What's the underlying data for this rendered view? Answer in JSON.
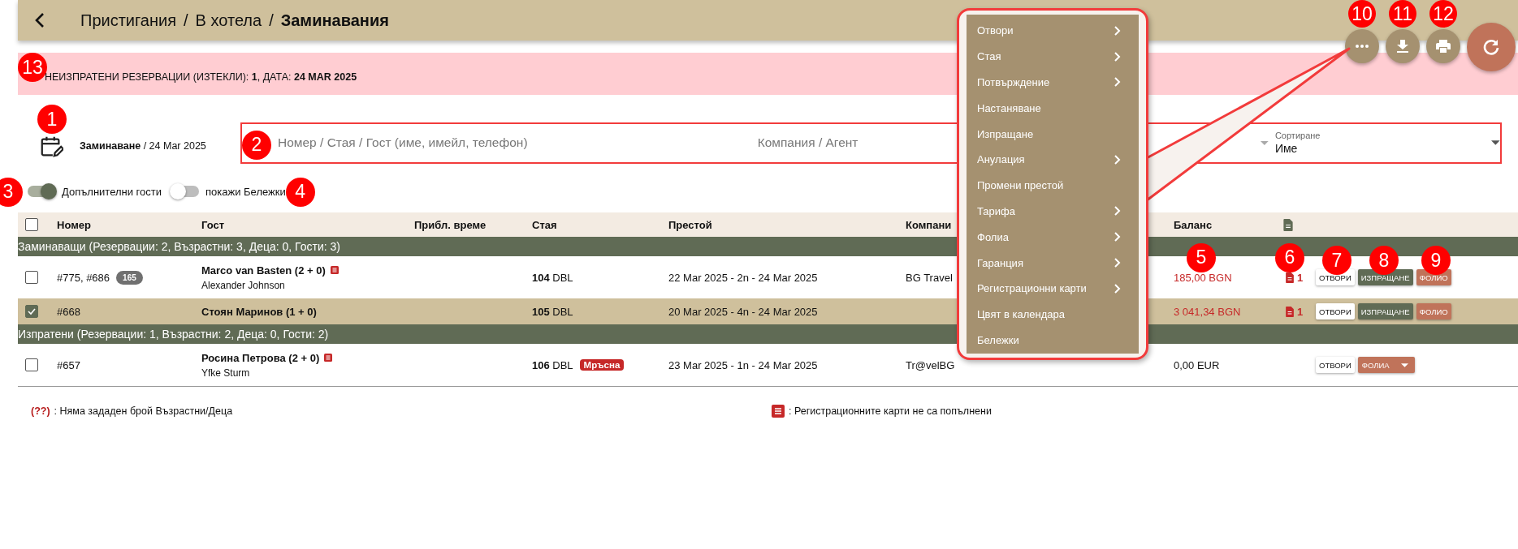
{
  "header": {
    "separator": "/",
    "breadcrumb": [
      {
        "label": "Пристигания",
        "current": false
      },
      {
        "label": "В хотела",
        "current": false
      },
      {
        "label": "Заминавания",
        "current": true
      }
    ]
  },
  "toolbar": [
    {
      "kind": "more",
      "callout": "10"
    },
    {
      "kind": "download",
      "callout": "11"
    },
    {
      "kind": "print",
      "callout": "12"
    },
    {
      "kind": "refresh"
    }
  ],
  "banner": {
    "text": "НЕИЗПРАТЕНИ РЕЗЕРВАЦИИ (ИЗТЕКЛИ): **1**, ДАТА: **24 MAR 2025**",
    "callout": "13"
  },
  "date": {
    "text": "**Заминаване** / 24 Mar 2025",
    "callout": "1"
  },
  "filters": {
    "callout": "2",
    "search_placeholder": "Номер / Стая / Гост (име, имейл, телефон)",
    "company_placeholder": "Компания / Агент",
    "sort": {
      "label": "Сортиране",
      "value": "Име"
    }
  },
  "toggles": [
    {
      "label": "Допълнителни гости",
      "on": true,
      "callout": "3"
    },
    {
      "label": "покажи Бележки",
      "on": false,
      "callout": "4"
    }
  ],
  "table": {
    "all_checked": false,
    "columns": [
      {
        "kind": "number",
        "label": "Номер"
      },
      {
        "kind": "guest",
        "label": "Гост"
      },
      {
        "kind": "time",
        "label": "Прибл. време"
      },
      {
        "kind": "room",
        "label": "Стая"
      },
      {
        "kind": "stay",
        "label": "Престой"
      },
      {
        "kind": "company",
        "label": "Компани"
      },
      {
        "kind": "balance",
        "label": "Баланс",
        "callout": "5"
      },
      {
        "kind": "docs",
        "callout": "6"
      },
      {
        "kind": "actions",
        "callouts": [
          "7",
          "8",
          "9"
        ]
      }
    ],
    "groups": [
      {
        "title": "Заминаващи (Резервации: 2, Възрастни: 3, Деца: 0, Гости: 3)",
        "rows": [
          {
            "selected": false,
            "checked": false,
            "number": "#775, #686",
            "badge": "165",
            "guest": "Marco van Basten (2 + 0)",
            "reg_card_missing": true,
            "subguest": "Alexander Johnson",
            "room_no": "104",
            "room_type": "DBL",
            "stay": "22 Mar 2025 - 2n - 24 Mar 2025",
            "company": "BG Travel",
            "balance": "185,00 BGN",
            "balance_due": true,
            "docs": "1",
            "actions": [
              {
                "kind": "open",
                "label": "ОТВОРИ"
              },
              {
                "kind": "checkout",
                "label": "ИЗПРАЩАНЕ"
              },
              {
                "kind": "folio",
                "label": "ФОЛИО"
              }
            ]
          },
          {
            "selected": true,
            "checked": true,
            "number": "#668",
            "guest": "Стоян Маринов (1 + 0)",
            "reg_card_missing": false,
            "room_no": "105",
            "room_type": "DBL",
            "stay": "20 Mar 2025 - 4n - 24 Mar 2025",
            "balance": "3 041,34 BGN",
            "balance_due": true,
            "docs": "1",
            "actions": [
              {
                "kind": "open",
                "label": "ОТВОРИ"
              },
              {
                "kind": "checkout",
                "label": "ИЗПРАЩАНЕ"
              },
              {
                "kind": "folio",
                "label": "ФОЛИО"
              }
            ]
          }
        ]
      },
      {
        "title": "Изпратени (Резервации: 1, Възрастни: 2, Деца: 0, Гости: 2)",
        "rows": [
          {
            "selected": false,
            "checked": false,
            "number": "#657",
            "guest": "Росина Петрова (2 + 0)",
            "reg_card_missing": true,
            "subguest": "Yfke Sturm",
            "room_no": "106",
            "room_type": "DBL",
            "room_tag": "Мръсна",
            "stay": "23 Mar 2025 - 1n - 24 Mar 2025",
            "company": "Tr@velBG",
            "balance": "0,00 EUR",
            "balance_due": false,
            "actions": [
              {
                "kind": "open",
                "label": "ОТВОРИ"
              },
              {
                "kind": "folio_menu",
                "label": "ФОЛИА"
              }
            ]
          }
        ]
      }
    ]
  },
  "legend": [
    {
      "kind": "symbol",
      "symbol": "(??)",
      "text": ": Няма зададен брой Възрастни/Деца"
    },
    {
      "kind": "icon",
      "text": ": Регистрационните карти не са попълнени"
    }
  ],
  "menu": [
    {
      "label": "Отвори",
      "submenu": true
    },
    {
      "label": "Стая",
      "submenu": true
    },
    {
      "label": "Потвърждение",
      "submenu": true
    },
    {
      "label": "Настаняване",
      "submenu": false
    },
    {
      "label": "Изпращане",
      "submenu": false
    },
    {
      "label": "Анулация",
      "submenu": true
    },
    {
      "label": "Промени престой",
      "submenu": false
    },
    {
      "label": "Тарифа",
      "submenu": true
    },
    {
      "label": "Фолиа",
      "submenu": true
    },
    {
      "label": "Гаранция",
      "submenu": true
    },
    {
      "label": "Регистрационни карти",
      "submenu": true
    },
    {
      "label": "Цвят в календара",
      "submenu": false
    },
    {
      "label": "Бележки",
      "submenu": false
    }
  ]
}
